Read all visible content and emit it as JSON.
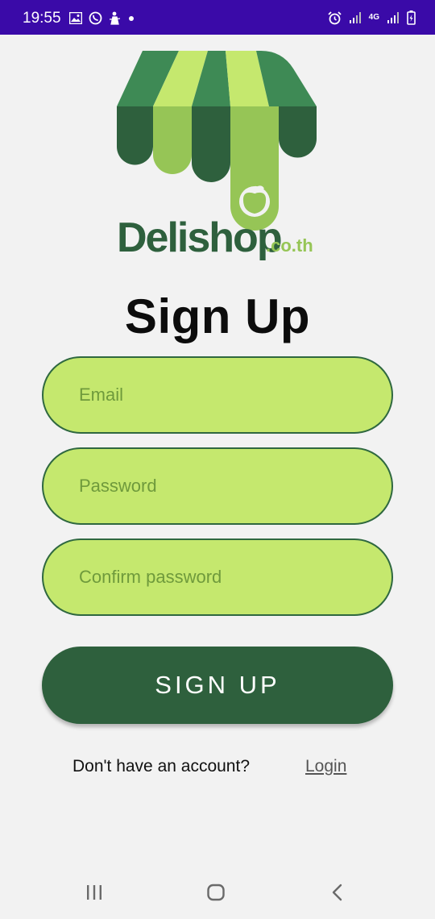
{
  "status_bar": {
    "time": "19:55",
    "left_icons": [
      "image-icon",
      "whatsapp-icon",
      "figure-icon",
      "dot-icon"
    ],
    "right_icons": [
      "alarm-icon",
      "signal-icon",
      "4g-icon",
      "signal-icon",
      "battery-icon"
    ],
    "network_label": "4G",
    "background": "#3a0aa8"
  },
  "logo": {
    "brand": "Delishop",
    "suffix": ".co.th",
    "colors": {
      "dark_green": "#2e603d",
      "mid_green": "#3e8a55",
      "light_green": "#c5e86e",
      "olive_green": "#96c556"
    }
  },
  "page": {
    "title": "Sign Up"
  },
  "form": {
    "email_placeholder": "Email",
    "password_placeholder": "Password",
    "confirm_placeholder": "Confirm password",
    "submit_label": "SIGN UP"
  },
  "footer": {
    "account_prompt": "Don't have an account?",
    "login_label": "Login"
  },
  "nav": {
    "icons": [
      "recent-apps-icon",
      "home-icon",
      "back-icon"
    ]
  }
}
